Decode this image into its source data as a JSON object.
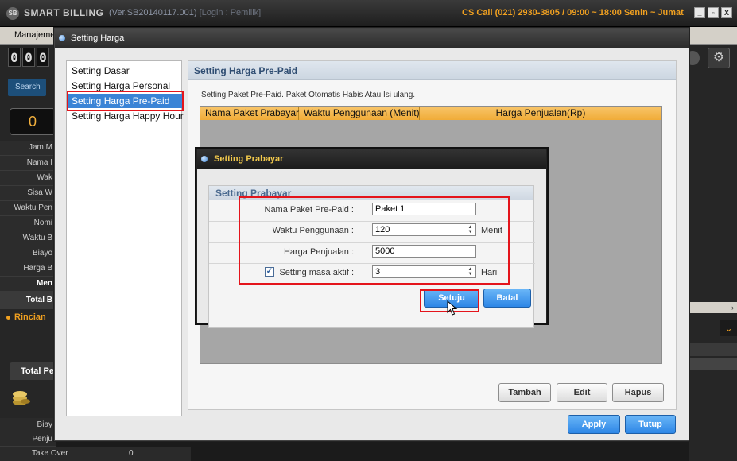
{
  "app": {
    "logo": "SB",
    "name": "SMART BILLING",
    "version": "(Ver.SB20140117.001)",
    "login": "[Login : Pemilik]",
    "cs_call": "CS Call (021) 2930-3805 / 09:00 ~ 18:00 Senin ~ Jumat",
    "menu_label": "Manajeme",
    "window_buttons": [
      "_",
      "▫",
      "X"
    ]
  },
  "background": {
    "counter_digits": [
      "0",
      "0",
      "0"
    ],
    "search_label": "Search",
    "zero_value": "0",
    "left_rows": [
      "Jam M",
      "Nama I",
      "Wak",
      "Sisa W",
      "Waktu Pen",
      "Nomi",
      "Waktu B",
      "Biayo",
      "Harga B",
      "Men",
      "Total B"
    ],
    "rincian": "Rincian",
    "total_tab": "Total Pe",
    "bottom_rows": [
      "Biay",
      "Penju"
    ],
    "takeover_label": "Take Over",
    "takeover_value": "0",
    "scroll_arrow": "›",
    "dropdown_arrow": "⌄",
    "gear_icon": "gear-icon"
  },
  "dialog": {
    "title": "Setting Harga",
    "nav": [
      "Setting Dasar",
      "Setting Harga Personal",
      "Setting Harga Pre-Paid",
      "Setting Harga Happy Hour"
    ],
    "selected_nav": "Setting Harga Pre-Paid",
    "panel_title": "Setting Harga Pre-Paid",
    "panel_desc": "Setting Paket Pre-Paid. Paket Otomatis Habis Atau Isi ulang.",
    "columns": [
      "Nama Paket Prabayar",
      "Waktu Penggunaan (Menit)",
      "Harga Penjualan(Rp)"
    ],
    "buttons": {
      "tambah": "Tambah",
      "edit": "Edit",
      "hapus": "Hapus",
      "apply": "Apply",
      "tutup": "Tutup"
    }
  },
  "inner": {
    "title": "Setting Prabayar",
    "panel_title": "Setting Prabayar",
    "fields": {
      "nama_label": "Nama Paket Pre-Paid :",
      "nama_value": "Paket 1",
      "waktu_label": "Waktu Penggunaan :",
      "waktu_value": "120",
      "waktu_unit": "Menit",
      "harga_label": "Harga Penjualan :",
      "harga_value": "5000",
      "masa_label": "Setting masa aktif :",
      "masa_checked": true,
      "masa_value": "3",
      "masa_unit": "Hari"
    },
    "buttons": {
      "setuju": "Setuju",
      "batal": "Batal"
    }
  },
  "colors": {
    "accent_orange": "#f0ac38",
    "selection_blue": "#3a84d6",
    "highlight_red": "#e4141b",
    "title_gold": "#f2c94c"
  }
}
